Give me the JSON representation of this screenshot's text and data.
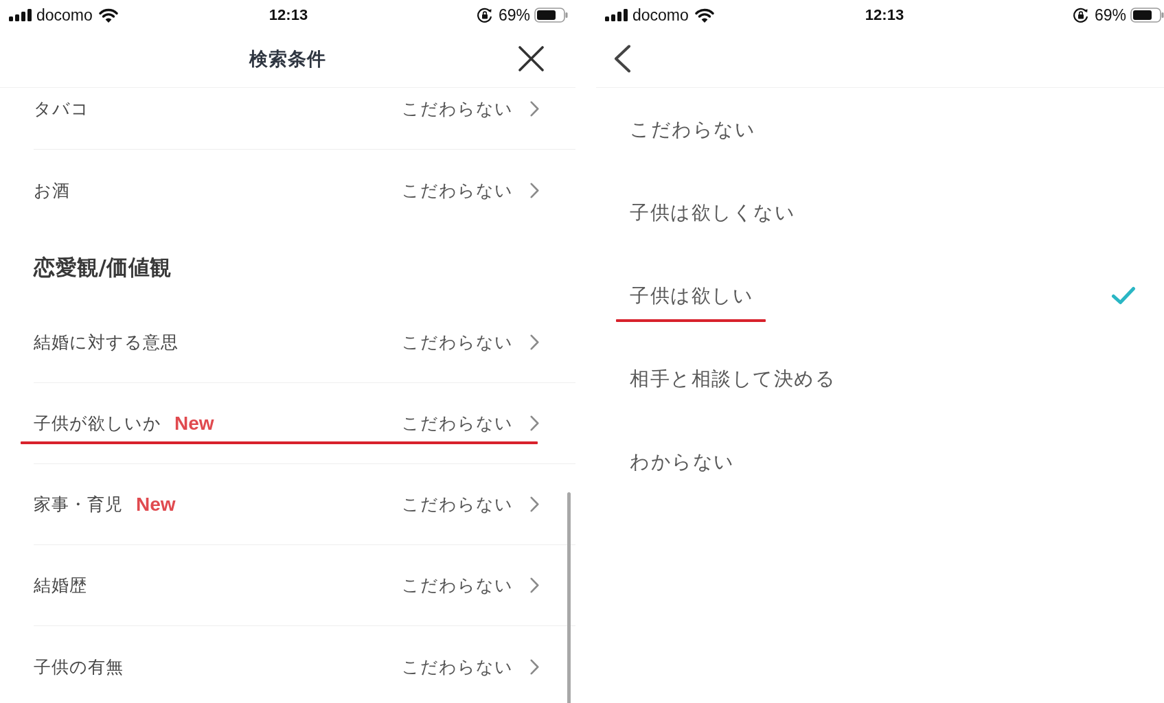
{
  "left_screen": {
    "status_bar": {
      "carrier": "docomo",
      "time": "12:13",
      "battery": "69%"
    },
    "header": {
      "kind": "close",
      "title": "検索条件"
    },
    "list": [
      {
        "kind": "row",
        "label": "タバコ",
        "value": "こだわらない",
        "underlined": false
      },
      {
        "kind": "row",
        "label": "お酒",
        "value": "こだわらない",
        "underlined": false
      },
      {
        "kind": "section",
        "title": "恋愛観/価値観"
      },
      {
        "kind": "row",
        "label": "結婚に対する意思",
        "value": "こだわらない",
        "underlined": false
      },
      {
        "kind": "row",
        "label": "子供が欲しいか",
        "badge": "New",
        "value": "こだわらない",
        "underlined": true
      },
      {
        "kind": "row",
        "label": "家事・育児",
        "badge": "New",
        "value": "こだわらない",
        "underlined": false
      },
      {
        "kind": "row",
        "label": "結婚歴",
        "value": "こだわらない",
        "underlined": false
      },
      {
        "kind": "row",
        "label": "子供の有無",
        "value": "こだわらない",
        "underlined": false
      }
    ]
  },
  "right_screen": {
    "status_bar": {
      "carrier": "docomo",
      "time": "12:13",
      "battery": "69%"
    },
    "header": {
      "kind": "back"
    },
    "options": [
      {
        "label": "こだわらない",
        "selected": false,
        "underlined": false
      },
      {
        "label": "子供は欲しくない",
        "selected": false,
        "underlined": false
      },
      {
        "label": "子供は欲しい",
        "selected": true,
        "underlined": true
      },
      {
        "label": "相手と相談して決める",
        "selected": false,
        "underlined": false
      },
      {
        "label": "わからない",
        "selected": false,
        "underlined": false
      }
    ]
  }
}
